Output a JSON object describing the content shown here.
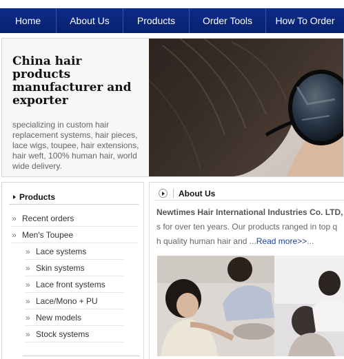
{
  "nav": {
    "items": [
      {
        "label": "Home"
      },
      {
        "label": "About Us"
      },
      {
        "label": "Products"
      },
      {
        "label": "Order Tools"
      },
      {
        "label": "How To Order"
      }
    ]
  },
  "hero": {
    "title": "China hair products manufacturer and exporter",
    "description": "specializing in custom hair replacement systems, hair pieces, lace wigs, toupee, hair extensions, hair weft, 100% human hair, world wide delivery."
  },
  "sidebar": {
    "heading": "Products",
    "items": [
      {
        "label": "Recent orders"
      },
      {
        "label": "Men's Toupee"
      },
      {
        "label": "Lace systems"
      },
      {
        "label": "Skin systems"
      },
      {
        "label": "Lace front systems"
      },
      {
        "label": "Lace/Mono + PU"
      },
      {
        "label": "New models"
      },
      {
        "label": "Stock systems"
      }
    ]
  },
  "about": {
    "heading": "About Us",
    "company": "Newtimes Hair International Industries Co. LTD, l",
    "line2": "s for over ten years.   Our products ranged in top q",
    "line3": "h quality human hair and ...",
    "read_more": "Read more>>",
    "read_more_tail": "..."
  },
  "icons": {
    "nav_divider": "divider",
    "sidebar_bullet": "triangle-right-icon",
    "about_bullet": "circle-arrow-icon"
  },
  "colors": {
    "nav_bg": "#0a2780",
    "link": "#1a3fa8"
  }
}
